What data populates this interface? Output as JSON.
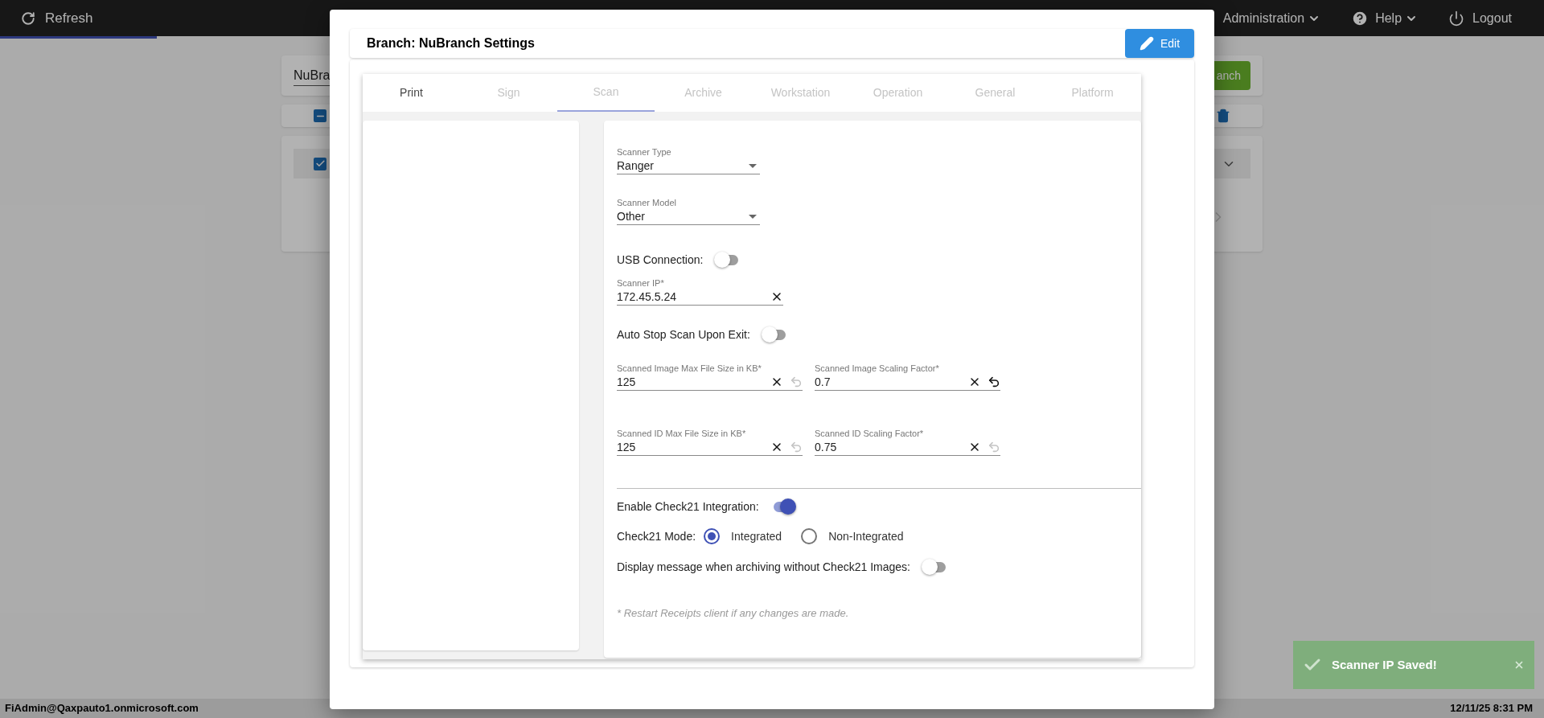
{
  "top_bar": {
    "refresh": "Refresh",
    "menus": [
      {
        "label": "Administration",
        "kind": "dropdown"
      },
      {
        "label": "Help",
        "kind": "help"
      },
      {
        "label": "Logout",
        "kind": "logout"
      }
    ]
  },
  "background": {
    "branch_field_value": "NuBra",
    "add_button": "anch",
    "list_checkbox": {
      "indeterminate": true
    },
    "row_checkbox": {
      "checked": true
    }
  },
  "modal": {
    "title": "Branch: NuBranch Settings",
    "edit_button": "Edit",
    "tabs": [
      {
        "label": "Print",
        "selected": false,
        "disabled": false
      },
      {
        "label": "Sign",
        "selected": false,
        "disabled": true
      },
      {
        "label": "Scan",
        "selected": true,
        "disabled": true
      },
      {
        "label": "Archive",
        "selected": false,
        "disabled": true
      },
      {
        "label": "Workstation",
        "selected": false,
        "disabled": true
      },
      {
        "label": "Operation",
        "selected": false,
        "disabled": true
      },
      {
        "label": "General",
        "selected": false,
        "disabled": true
      },
      {
        "label": "Platform",
        "selected": false,
        "disabled": true
      }
    ],
    "scanner_rows": [
      {
        "kind": "select",
        "label": "Scanner Type",
        "value": "Ranger"
      },
      {
        "kind": "select",
        "label": "Scanner Model",
        "value": "Other"
      },
      {
        "kind": "toggle",
        "label": "USB Connection:",
        "on": false
      },
      {
        "kind": "text",
        "label": "Scanner IP*",
        "value": "172.45.5.24"
      },
      {
        "kind": "toggle",
        "label": "Auto Stop Scan Upon Exit:",
        "on": false
      },
      {
        "kind": "pair",
        "fields": [
          {
            "label": "Scanned Image Max File Size in KB*",
            "value": "125",
            "undo_enabled": false
          },
          {
            "label": "Scanned Image Scaling Factor*",
            "value": "0.7",
            "undo_enabled": true
          }
        ]
      },
      {
        "kind": "pair",
        "fields": [
          {
            "label": "Scanned ID Max File Size in KB*",
            "value": "125",
            "undo_enabled": false
          },
          {
            "label": "Scanned ID Scaling Factor*",
            "value": "0.75",
            "undo_enabled": false
          }
        ]
      }
    ],
    "check21_rows": [
      {
        "kind": "toggle",
        "label": "Enable Check21 Integration:",
        "on": true
      },
      {
        "kind": "radio",
        "label": "Check21 Mode:",
        "options": [
          {
            "label": "Integrated",
            "selected": true
          },
          {
            "label": "Non-Integrated",
            "selected": false
          }
        ]
      },
      {
        "kind": "toggle",
        "label": "Display message when archiving without Check21 Images:",
        "on": false
      }
    ],
    "note": "* Restart Receipts client if any changes are made."
  },
  "status_bar": {
    "user": "FiAdmin@Qaxpauto1.onmicrosoft.com",
    "datetime": "12/11/25 8:31 PM"
  },
  "toast": {
    "message": "Scanner IP Saved!"
  }
}
